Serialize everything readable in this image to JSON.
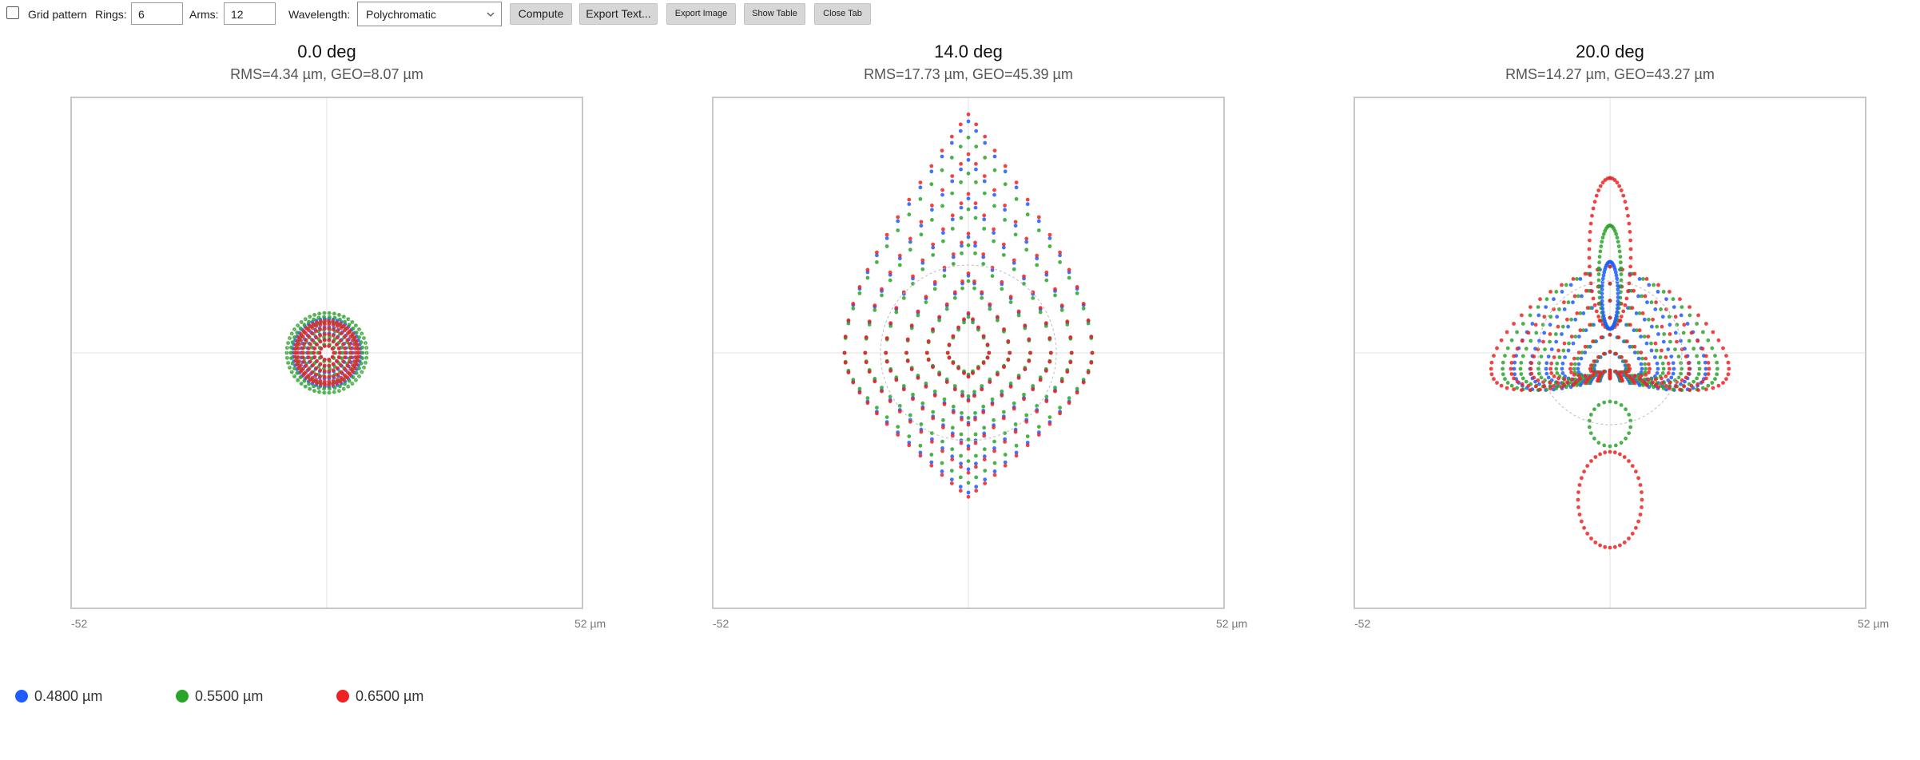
{
  "toolbar": {
    "grid_pattern_label": "Grid pattern",
    "grid_pattern_checked": false,
    "rings_label": "Rings:",
    "rings_value": "6",
    "arms_label": "Arms:",
    "arms_value": "12",
    "wavelength_label": "Wavelength:",
    "wavelength_value": "Polychromatic",
    "compute_label": "Compute",
    "export_text_label": "Export Text...",
    "export_image_label": "Export Image",
    "show_table_label": "Show Table",
    "close_tab_label": "Close Tab"
  },
  "panels": [
    {
      "title": "0.0 deg",
      "subtitle": "RMS=4.34 µm, GEO=8.07 µm",
      "axis_min": "-52",
      "axis_max": "52 µm"
    },
    {
      "title": "14.0 deg",
      "subtitle": "RMS=17.73 µm, GEO=45.39 µm",
      "axis_min": "-52",
      "axis_max": "52 µm"
    },
    {
      "title": "20.0 deg",
      "subtitle": "RMS=14.27 µm, GEO=43.27 µm",
      "axis_min": "-52",
      "axis_max": "52 µm"
    }
  ],
  "legend": [
    {
      "label": "0.4800 µm",
      "color": "#1f5cff"
    },
    {
      "label": "0.5500 µm",
      "color": "#2aa52a"
    },
    {
      "label": "0.6500 µm",
      "color": "#ee2222"
    }
  ],
  "colors": {
    "blue": "#1f5cff",
    "green": "#2aa52a",
    "red": "#ee2222",
    "frame": "#c8c8c8",
    "crosshair": "#e2e2e2"
  }
}
